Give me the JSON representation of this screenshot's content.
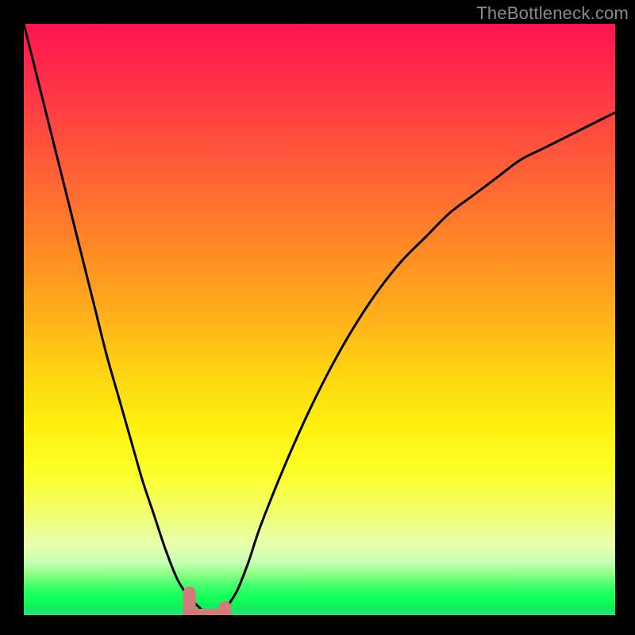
{
  "watermark": {
    "text": "TheBottleneck.com"
  },
  "chart_data": {
    "type": "line",
    "title": "",
    "xlabel": "",
    "ylabel": "",
    "ylim": [
      0,
      100
    ],
    "xlim": [
      0,
      100
    ],
    "x": [
      0,
      2,
      4,
      6,
      8,
      10,
      12,
      14,
      16,
      18,
      20,
      22,
      24,
      26,
      28,
      30,
      31,
      32,
      33,
      34,
      36,
      38,
      40,
      44,
      48,
      52,
      56,
      60,
      64,
      68,
      72,
      76,
      80,
      84,
      88,
      92,
      96,
      100
    ],
    "values": [
      100,
      92,
      84,
      76,
      68,
      60,
      52,
      44,
      37,
      30,
      23,
      17,
      11,
      6,
      3,
      1,
      0,
      0,
      0,
      1,
      4,
      9,
      15,
      25,
      34,
      42,
      49,
      55,
      60,
      64,
      68,
      71,
      74,
      77,
      79,
      81,
      83,
      85
    ],
    "minimum_marker": {
      "x_range": [
        28,
        34
      ],
      "y": 0,
      "color": "#d47a78"
    }
  }
}
